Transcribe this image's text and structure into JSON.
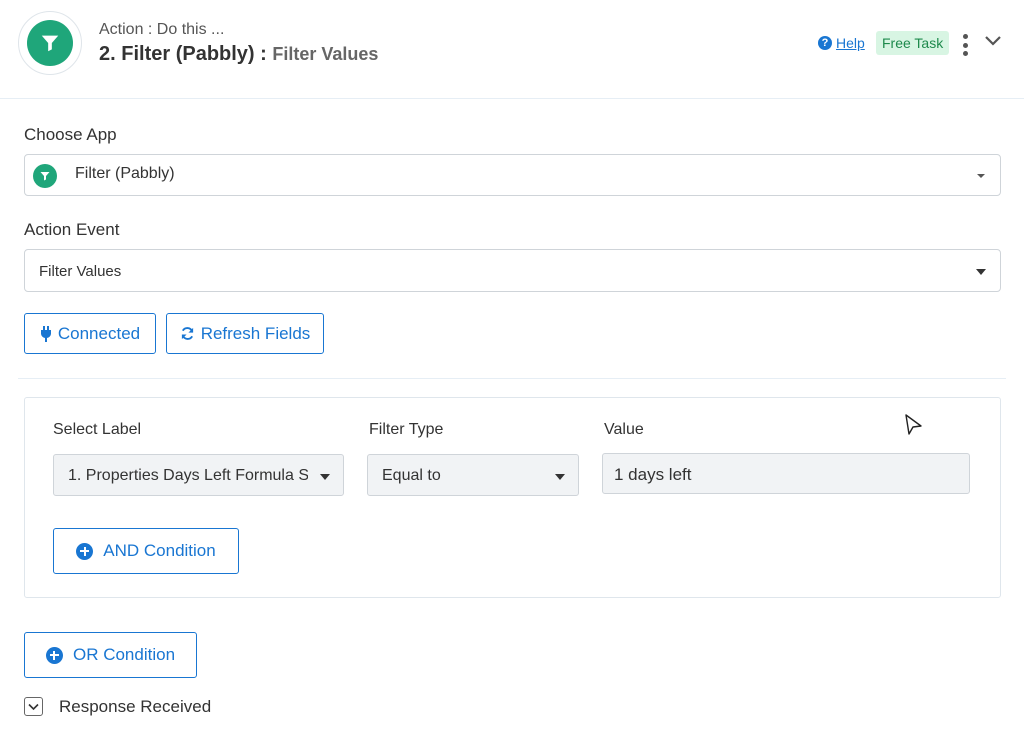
{
  "header": {
    "kicker": "Action : Do this ...",
    "title": "2. Filter (Pabbly) :",
    "subtitle": "Filter Values",
    "help_icon_glyph": "?",
    "help_label": "Help",
    "badge": "Free Task",
    "icon": "filter-funnel-icon",
    "brand_color": "#1fa67a"
  },
  "choose_app": {
    "label": "Choose App",
    "value": "Filter (Pabbly)",
    "icon": "filter-funnel-icon"
  },
  "action_event": {
    "label": "Action Event",
    "value": "Filter Values"
  },
  "buttons": {
    "connected": "Connected",
    "refresh": "Refresh Fields",
    "accent_color": "#1976d2"
  },
  "condition": {
    "select_label_header": "Select Label",
    "select_label_value": "1. Properties Days Left Formula S",
    "filter_type_header": "Filter Type",
    "filter_type_value": "Equal to",
    "value_header": "Value",
    "value_text": "1 days left",
    "and_button": "AND Condition"
  },
  "or_button": "OR Condition",
  "response": {
    "label": "Response Received"
  }
}
